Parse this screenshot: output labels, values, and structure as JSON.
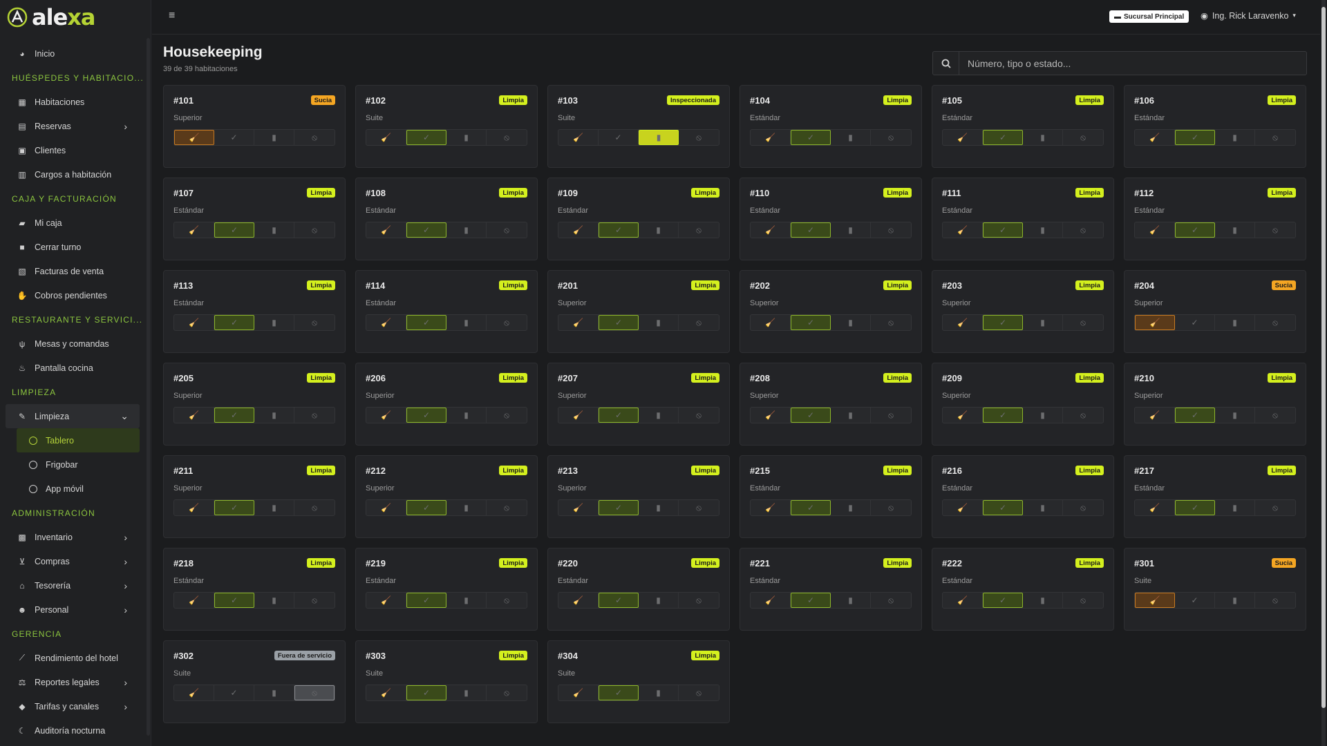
{
  "app": {
    "name_prefix": "ale",
    "name_accent": "xa"
  },
  "topbar": {
    "branch": "Sucursal Principal",
    "user": "Ing. Rick Laravenko"
  },
  "sidebar": {
    "items": [
      {
        "type": "item",
        "label": "Inicio",
        "icon": "palette-icon"
      },
      {
        "type": "section",
        "label": "HUÉSPEDES Y HABITACIO..."
      },
      {
        "type": "item",
        "label": "Habitaciones",
        "icon": "grid-icon"
      },
      {
        "type": "item",
        "label": "Reservas",
        "icon": "calendar-icon",
        "chevron": "›"
      },
      {
        "type": "item",
        "label": "Clientes",
        "icon": "id-card-icon"
      },
      {
        "type": "item",
        "label": "Cargos a habitación",
        "icon": "receipt-icon"
      },
      {
        "type": "section",
        "label": "CAJA Y FACTURACIÓN"
      },
      {
        "type": "item",
        "label": "Mi caja",
        "icon": "cash-register-icon"
      },
      {
        "type": "item",
        "label": "Cerrar turno",
        "icon": "lock-icon"
      },
      {
        "type": "item",
        "label": "Facturas de venta",
        "icon": "invoice-icon"
      },
      {
        "type": "item",
        "label": "Cobros pendientes",
        "icon": "hand-coin-icon"
      },
      {
        "type": "section",
        "label": "RESTAURANTE Y SERVICI..."
      },
      {
        "type": "item",
        "label": "Mesas y comandas",
        "icon": "utensils-icon"
      },
      {
        "type": "item",
        "label": "Pantalla cocina",
        "icon": "fire-icon"
      },
      {
        "type": "section",
        "label": "LIMPIEZA"
      },
      {
        "type": "open",
        "label": "Limpieza",
        "icon": "broom-icon",
        "chevron": "⌄"
      },
      {
        "type": "active",
        "label": "Tablero"
      },
      {
        "type": "sub",
        "label": "Frigobar"
      },
      {
        "type": "sub",
        "label": "App móvil"
      },
      {
        "type": "section",
        "label": "ADMINISTRACIÓN"
      },
      {
        "type": "item",
        "label": "Inventario",
        "icon": "boxes-icon",
        "chevron": "›"
      },
      {
        "type": "item",
        "label": "Compras",
        "icon": "cart-icon",
        "chevron": "›"
      },
      {
        "type": "item",
        "label": "Tesorería",
        "icon": "bank-icon",
        "chevron": "›"
      },
      {
        "type": "item",
        "label": "Personal",
        "icon": "users-icon",
        "chevron": "›"
      },
      {
        "type": "section",
        "label": "GERENCIA"
      },
      {
        "type": "item",
        "label": "Rendimiento del hotel",
        "icon": "chart-line-icon"
      },
      {
        "type": "item",
        "label": "Reportes legales",
        "icon": "scale-icon",
        "chevron": "›"
      },
      {
        "type": "item",
        "label": "Tarifas y canales",
        "icon": "tags-icon",
        "chevron": "›"
      },
      {
        "type": "item",
        "label": "Auditoría nocturna",
        "icon": "moon-icon"
      }
    ]
  },
  "page": {
    "title": "Housekeeping",
    "subtitle": "39 de 39 habitaciones"
  },
  "search": {
    "placeholder": "Número, tipo o estado..."
  },
  "rooms": [
    {
      "num": "#101",
      "type": "Superior",
      "status": "Sucia",
      "active": 0
    },
    {
      "num": "#102",
      "type": "Suite",
      "status": "Limpia",
      "active": 1
    },
    {
      "num": "#103",
      "type": "Suite",
      "status": "Inspeccionada",
      "active": 2
    },
    {
      "num": "#104",
      "type": "Estándar",
      "status": "Limpia",
      "active": 1
    },
    {
      "num": "#105",
      "type": "Estándar",
      "status": "Limpia",
      "active": 1
    },
    {
      "num": "#106",
      "type": "Estándar",
      "status": "Limpia",
      "active": 1
    },
    {
      "num": "#107",
      "type": "Estándar",
      "status": "Limpia",
      "active": 1
    },
    {
      "num": "#108",
      "type": "Estándar",
      "status": "Limpia",
      "active": 1
    },
    {
      "num": "#109",
      "type": "Estándar",
      "status": "Limpia",
      "active": 1
    },
    {
      "num": "#110",
      "type": "Estándar",
      "status": "Limpia",
      "active": 1
    },
    {
      "num": "#111",
      "type": "Estándar",
      "status": "Limpia",
      "active": 1
    },
    {
      "num": "#112",
      "type": "Estándar",
      "status": "Limpia",
      "active": 1
    },
    {
      "num": "#113",
      "type": "Estándar",
      "status": "Limpia",
      "active": 1
    },
    {
      "num": "#114",
      "type": "Estándar",
      "status": "Limpia",
      "active": 1
    },
    {
      "num": "#201",
      "type": "Superior",
      "status": "Limpia",
      "active": 1
    },
    {
      "num": "#202",
      "type": "Superior",
      "status": "Limpia",
      "active": 1
    },
    {
      "num": "#203",
      "type": "Superior",
      "status": "Limpia",
      "active": 1
    },
    {
      "num": "#204",
      "type": "Superior",
      "status": "Sucia",
      "active": 0
    },
    {
      "num": "#205",
      "type": "Superior",
      "status": "Limpia",
      "active": 1
    },
    {
      "num": "#206",
      "type": "Superior",
      "status": "Limpia",
      "active": 1
    },
    {
      "num": "#207",
      "type": "Superior",
      "status": "Limpia",
      "active": 1
    },
    {
      "num": "#208",
      "type": "Superior",
      "status": "Limpia",
      "active": 1
    },
    {
      "num": "#209",
      "type": "Superior",
      "status": "Limpia",
      "active": 1
    },
    {
      "num": "#210",
      "type": "Superior",
      "status": "Limpia",
      "active": 1
    },
    {
      "num": "#211",
      "type": "Superior",
      "status": "Limpia",
      "active": 1
    },
    {
      "num": "#212",
      "type": "Superior",
      "status": "Limpia",
      "active": 1
    },
    {
      "num": "#213",
      "type": "Superior",
      "status": "Limpia",
      "active": 1
    },
    {
      "num": "#215",
      "type": "Estándar",
      "status": "Limpia",
      "active": 1
    },
    {
      "num": "#216",
      "type": "Estándar",
      "status": "Limpia",
      "active": 1
    },
    {
      "num": "#217",
      "type": "Estándar",
      "status": "Limpia",
      "active": 1
    },
    {
      "num": "#218",
      "type": "Estándar",
      "status": "Limpia",
      "active": 1
    },
    {
      "num": "#219",
      "type": "Estándar",
      "status": "Limpia",
      "active": 1
    },
    {
      "num": "#220",
      "type": "Estándar",
      "status": "Limpia",
      "active": 1
    },
    {
      "num": "#221",
      "type": "Estándar",
      "status": "Limpia",
      "active": 1
    },
    {
      "num": "#222",
      "type": "Estándar",
      "status": "Limpia",
      "active": 1
    },
    {
      "num": "#301",
      "type": "Suite",
      "status": "Sucia",
      "active": 0
    },
    {
      "num": "#302",
      "type": "Suite",
      "status": "Fuera de servicio",
      "active": 3
    },
    {
      "num": "#303",
      "type": "Suite",
      "status": "Limpia",
      "active": 1
    },
    {
      "num": "#304",
      "type": "Suite",
      "status": "Limpia",
      "active": 1
    }
  ],
  "action_glyphs": [
    "🧹",
    "✓",
    "▮",
    "⦸"
  ],
  "action_names": [
    "broom-icon",
    "check-icon",
    "clipboard-icon",
    "ban-icon"
  ],
  "colors": {
    "accent": "#b7d53a",
    "clean": "#d4f01e",
    "dirty": "#f5a623",
    "out_of_service": "#9aa0a6"
  }
}
